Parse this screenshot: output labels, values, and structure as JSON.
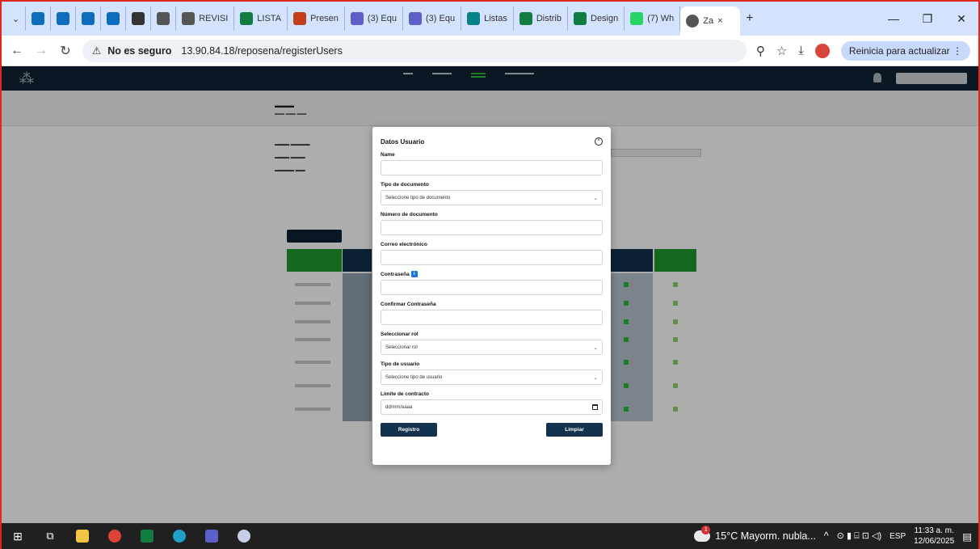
{
  "browser": {
    "tabs": [
      {
        "label": "",
        "icon": "outlook-icon",
        "color": "#0f6cbd"
      },
      {
        "label": "",
        "icon": "outlook-icon",
        "color": "#0f6cbd"
      },
      {
        "label": "",
        "icon": "file-icon",
        "color": "#0f6cbd"
      },
      {
        "label": "",
        "icon": "cloud-icon",
        "color": "#0f6cbd"
      },
      {
        "label": "",
        "icon": "g-icon",
        "color": "#333333"
      },
      {
        "label": "",
        "icon": "globe-icon",
        "color": "#555555"
      },
      {
        "label": "REVISI",
        "icon": "globe-icon",
        "color": "#555555"
      },
      {
        "label": "LISTA",
        "icon": "excel-icon",
        "color": "#107c41"
      },
      {
        "label": "Presen",
        "icon": "powerpoint-icon",
        "color": "#c43e1c"
      },
      {
        "label": "(3) Equ",
        "icon": "teams-icon",
        "color": "#5b5fc7"
      },
      {
        "label": "(3) Equ",
        "icon": "teams-icon",
        "color": "#5b5fc7"
      },
      {
        "label": "Listas",
        "icon": "sharepoint-icon",
        "color": "#038387"
      },
      {
        "label": "Distrib",
        "icon": "excel-icon",
        "color": "#107c41"
      },
      {
        "label": "Design",
        "icon": "excel-icon",
        "color": "#107c41"
      },
      {
        "label": "(7) Wh",
        "icon": "whatsapp-icon",
        "color": "#25d366"
      }
    ],
    "active_tab": {
      "label": "Za",
      "close": "×"
    },
    "new_tab": "+",
    "window_controls": {
      "minimize": "—",
      "restore": "❐",
      "close": "✕"
    },
    "address": {
      "security": "No es seguro",
      "url": "13.90.84.18/reposena/registerUsers"
    },
    "update_button": "Reinicia para actualizar"
  },
  "modal": {
    "title": "Datos Usuario",
    "fields": {
      "name_label": "Name",
      "doc_type_label": "Tipo de documento",
      "doc_type_value": "Seleccione tipo de documento",
      "doc_number_label": "Número de documento",
      "email_label": "Correo electrónico",
      "password_label": "Contraseña",
      "confirm_label": "Confirmar Contraseña",
      "role_label": "Seleccionar rol",
      "role_value": "Seleccionar rol",
      "user_type_label": "Tipo de usuario",
      "user_type_value": "Seleccione tipo de usuario",
      "limit_label": "Limite de contracto",
      "limit_placeholder": "dd/mm/aaaa"
    },
    "register_button": "Registro",
    "clear_button": "Limpiar"
  },
  "taskbar": {
    "weather": "15°C  Mayorm. nubla...",
    "lang": "ESP",
    "time": "11:33 a. m.",
    "date": "12/06/2025"
  }
}
